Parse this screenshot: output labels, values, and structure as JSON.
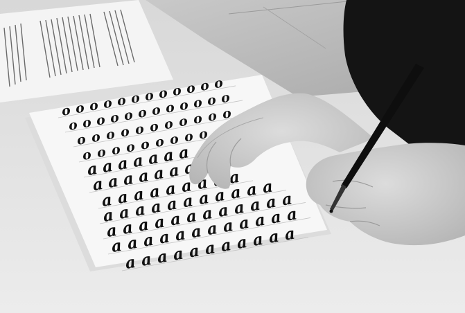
{
  "photo": {
    "mode": "grayscale",
    "subject": "calligraphy practice",
    "practice_rows": [
      {
        "glyph": "o",
        "count": 12
      },
      {
        "glyph": "o",
        "count": 12
      },
      {
        "glyph": "o",
        "count": 11
      },
      {
        "glyph": "o",
        "count": 9
      },
      {
        "glyph": "a",
        "count": 7
      },
      {
        "glyph": "a",
        "count": 7
      },
      {
        "glyph": "a",
        "count": 9
      },
      {
        "glyph": "a",
        "count": 11
      },
      {
        "glyph": "a",
        "count": 12
      },
      {
        "glyph": "a",
        "count": 12
      },
      {
        "glyph": "a",
        "count": 11
      }
    ],
    "colors": {
      "table": "#e4e4e4",
      "paper": "#f7f7f7",
      "ink": "#111111",
      "skin": "#d2d2d2",
      "sleeve": "#141414",
      "floor": "#bdbdbd"
    }
  }
}
